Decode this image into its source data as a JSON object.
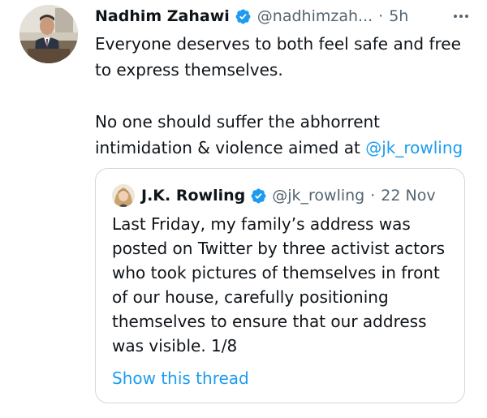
{
  "tweet": {
    "author_name": "Nadhim Zahawi",
    "author_handle": "@nadhimzah...",
    "separator": "·",
    "time": "5h",
    "more_icon": "more-dots-icon",
    "paragraph1": "Everyone deserves to both feel safe and free to express themselves.",
    "paragraph2_prefix": "No one should suffer the abhorrent intimidation & violence aimed at ",
    "mention": "@jk_rowling"
  },
  "quoted": {
    "author_name": "J.K. Rowling",
    "author_handle": "@jk_rowling",
    "separator": "·",
    "date": "22 Nov",
    "text": "Last Friday, my family’s address was posted on Twitter by three activist actors who took pictures of themselves in front of our house, carefully positioning themselves to ensure that our address was visible. 1/8",
    "link_label": "Show this thread"
  },
  "colors": {
    "accent": "#1d9bf0",
    "text_primary": "#0f1419",
    "text_secondary": "#536471",
    "border": "#cfd9de"
  },
  "icons": {
    "verified": "verified-badge-icon",
    "more": "more-dots-icon"
  }
}
